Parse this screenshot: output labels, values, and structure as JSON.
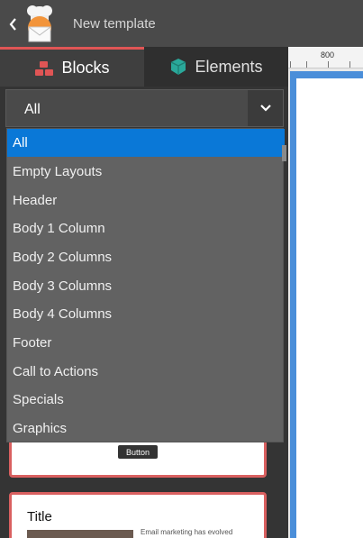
{
  "header": {
    "title": "New template"
  },
  "tabs": [
    {
      "label": "Blocks",
      "icon": "blocks-icon",
      "active": true,
      "color": "#e05555"
    },
    {
      "label": "Elements",
      "icon": "cube-icon",
      "active": false,
      "color": "#2aa89a"
    }
  ],
  "ruler": {
    "label": "800"
  },
  "category_select": {
    "value": "All",
    "options": [
      "All",
      "Empty Layouts",
      "Header",
      "Body 1 Column",
      "Body 2 Columns",
      "Body 3 Columns",
      "Body 4 Columns",
      "Footer",
      "Call to Actions",
      "Specials",
      "Graphics"
    ],
    "selected_index": 0
  },
  "preview_cards": [
    {
      "button_label": "Button"
    },
    {
      "title": "Title",
      "text": "Email marketing has evolved"
    }
  ],
  "colors": {
    "accent": "#e05555",
    "selection": "#0a78d7",
    "canvas_border": "#4a8ed9"
  }
}
